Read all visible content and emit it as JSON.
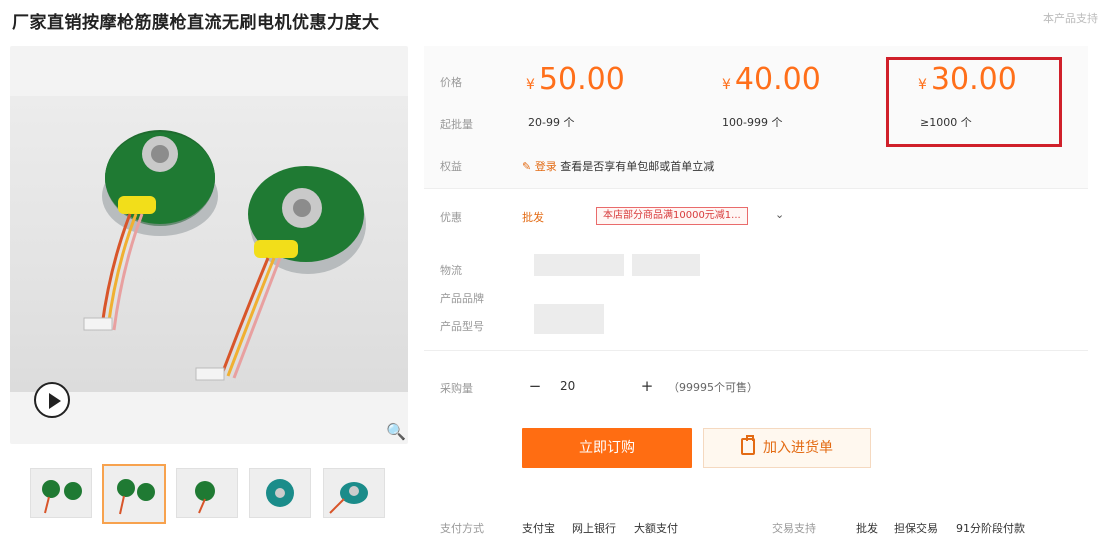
{
  "page": {
    "title": "厂家直销按摩枪筋膜枪直流无刷电机优惠力度大",
    "report_link": "本产品支持"
  },
  "gallery": {
    "thumbnails": [
      "thumb-1",
      "thumb-2",
      "thumb-3",
      "thumb-4",
      "thumb-5"
    ],
    "active_thumbnail_index": 1
  },
  "pricing": {
    "price_label": "价格",
    "moq_label": "起批量",
    "currency": "¥",
    "tiers": [
      {
        "price": "50.00",
        "range": "20-99 个"
      },
      {
        "price": "40.00",
        "range": "100-999 个"
      },
      {
        "price": "30.00",
        "range": "≥1000 个"
      }
    ],
    "price_color": "#ff6f1a",
    "highlight_color": "#d0202a"
  },
  "rights": {
    "label": "权益",
    "login_text": "登录",
    "desc": "查看是否享有单包邮或首单立减"
  },
  "promo": {
    "label": "优惠",
    "wholesale": "批发",
    "coupon": "本店部分商品满10000元减1..."
  },
  "details": {
    "shipping_label": "物流",
    "brand_label": "产品品牌",
    "model_label": "产品型号"
  },
  "order": {
    "qty_label": "采购量",
    "quantity": "20",
    "minus": "−",
    "plus": "+",
    "stock": "（99995个可售）",
    "buy_button": "立即订购",
    "cart_button": "加入进货单"
  },
  "footer": {
    "payment_label": "支付方式",
    "payments": [
      "支付宝",
      "网上银行",
      "大额支付"
    ],
    "trade_label": "交易支持",
    "trade_options": [
      "批发",
      "担保交易",
      "91分阶段付款"
    ]
  }
}
